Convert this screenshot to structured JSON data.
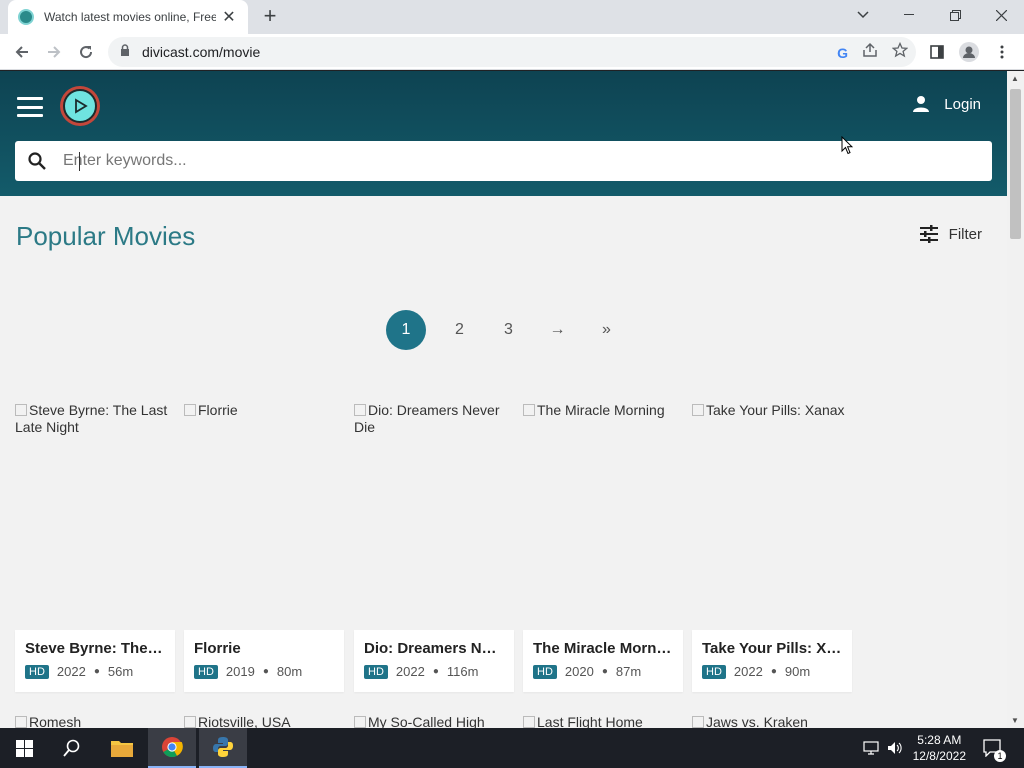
{
  "browser": {
    "tab_title": "Watch latest movies online, Free",
    "url": "divicast.com/movie"
  },
  "site": {
    "login_label": "Login",
    "search_placeholder": "Enter keywords...",
    "page_title": "Popular Movies",
    "filter_label": "Filter"
  },
  "pagination": {
    "pages": [
      "1",
      "2",
      "3"
    ],
    "active": "1",
    "next": "→",
    "last": "»"
  },
  "movies": [
    {
      "alt": "Steve Byrne: The Last Late Night",
      "title": "Steve Byrne: The Last Late Night",
      "quality": "HD",
      "year": "2022",
      "duration": "56m"
    },
    {
      "alt": "Florrie",
      "title": "Florrie",
      "quality": "HD",
      "year": "2019",
      "duration": "80m"
    },
    {
      "alt": "Dio: Dreamers Never Die",
      "title": "Dio: Dreamers Never Die",
      "quality": "HD",
      "year": "2022",
      "duration": "116m"
    },
    {
      "alt": "The Miracle Morning",
      "title": "The Miracle Morning",
      "quality": "HD",
      "year": "2020",
      "duration": "87m"
    },
    {
      "alt": "Take Your Pills: Xanax",
      "title": "Take Your Pills: Xanax",
      "quality": "HD",
      "year": "2022",
      "duration": "90m"
    }
  ],
  "next_row": [
    "Romesh",
    "Riotsville, USA",
    "My So-Called High",
    "Last Flight Home",
    "Jaws vs. Kraken"
  ],
  "taskbar": {
    "time": "5:28 AM",
    "date": "12/8/2022",
    "notification_count": "1"
  },
  "colors": {
    "header": "#135b6a",
    "accent": "#1f7489",
    "title": "#2c7a86"
  }
}
